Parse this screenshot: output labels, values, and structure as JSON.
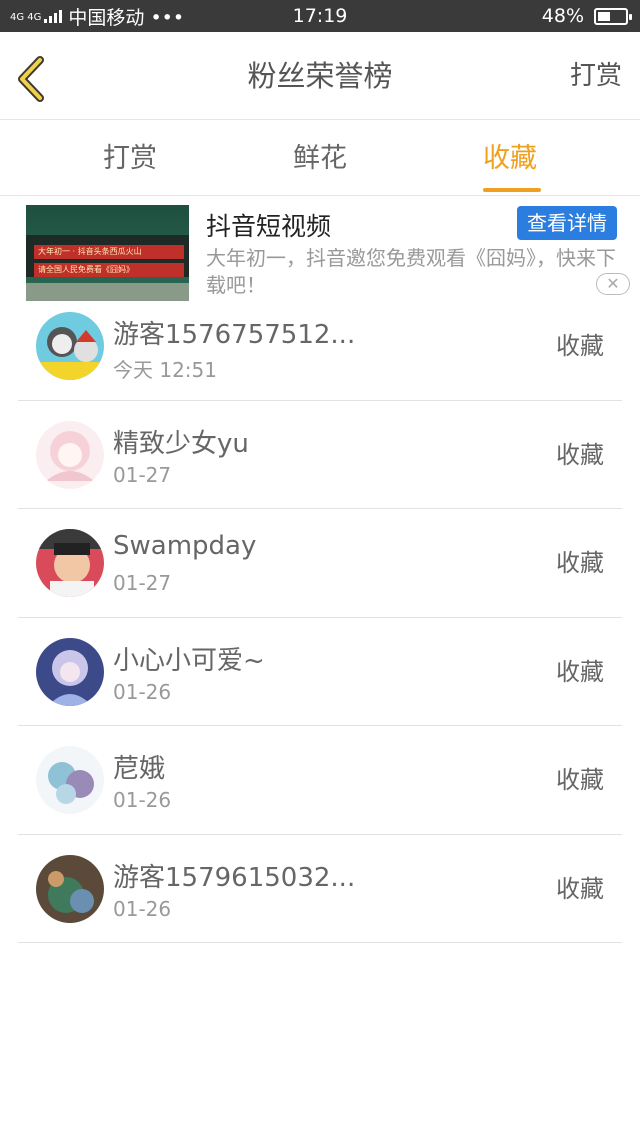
{
  "status_bar": {
    "network": "4G 4G",
    "carrier": "中国移动 •••",
    "time": "17:19",
    "battery": "48%",
    "battery_level": 0.48
  },
  "header": {
    "back_icon": "chevron-left-icon",
    "title": "粉丝荣誉榜",
    "action_label": "打赏"
  },
  "tabs": [
    {
      "label": "打赏",
      "active": false
    },
    {
      "label": "鲜花",
      "active": false
    },
    {
      "label": "收藏",
      "active": true
    }
  ],
  "accent_color": "#f0a020",
  "ad": {
    "title": "抖音短视频",
    "cta": "查看详情",
    "description": "大年初一，抖音邀您免费观看《囧妈》，快来下载吧！",
    "thumb_line1": "大年初一 · 抖音头条西瓜火山",
    "thumb_line2": "请全国人民免费看《囧妈》",
    "close_icon": "close-icon"
  },
  "fans": [
    {
      "name": "游客1576757512...",
      "date": "今天 12:51",
      "action": "收藏",
      "avatar_color": "#4fb8d0"
    },
    {
      "name": "精致少女yu",
      "date": "01-27",
      "action": "收藏",
      "avatar_color": "#f6d6dc"
    },
    {
      "name": "Swampday",
      "date": "01-27",
      "action": "收藏",
      "avatar_color": "#c76a4f"
    },
    {
      "name": "小心小可爱~",
      "date": "01-26",
      "action": "收藏",
      "avatar_color": "#6d73b8"
    },
    {
      "name": "苨娥",
      "date": "01-26",
      "action": "收藏",
      "avatar_color": "#a9c6da"
    },
    {
      "name": "游客1579615032...",
      "date": "01-26",
      "action": "收藏",
      "avatar_color": "#4e6a55"
    }
  ]
}
